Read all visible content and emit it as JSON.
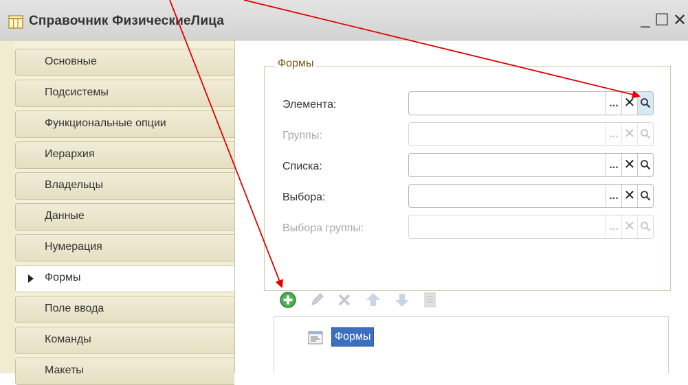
{
  "window": {
    "title": "Справочник ФизическиеЛица",
    "min_label": "_",
    "max_label": "☐",
    "close_label": "✕"
  },
  "nav": {
    "items": [
      {
        "label": "Основные"
      },
      {
        "label": "Подсистемы"
      },
      {
        "label": "Функциональные опции"
      },
      {
        "label": "Иерархия"
      },
      {
        "label": "Владельцы"
      },
      {
        "label": "Данные"
      },
      {
        "label": "Нумерация"
      },
      {
        "label": "Формы",
        "active": true
      },
      {
        "label": "Поле ввода"
      },
      {
        "label": "Команды"
      },
      {
        "label": "Макеты"
      }
    ]
  },
  "forms_group": {
    "title": "Формы",
    "fields": [
      {
        "label": "Элемента:",
        "value": "",
        "enabled": true
      },
      {
        "label": "Группы:",
        "value": "",
        "enabled": false
      },
      {
        "label": "Списка:",
        "value": "",
        "enabled": true
      },
      {
        "label": "Выбора:",
        "value": "",
        "enabled": true
      },
      {
        "label": "Выбора группы:",
        "value": "",
        "enabled": false
      }
    ],
    "field_buttons": {
      "select": "...",
      "clear": "✕",
      "open": "search-icon"
    }
  },
  "toolbar": {
    "icons": [
      "add-icon",
      "edit-icon",
      "delete-icon",
      "move-up-icon",
      "move-down-icon",
      "properties-icon"
    ]
  },
  "tree": {
    "nodes": [
      {
        "label": "Формы",
        "selected": true
      }
    ]
  },
  "colors": {
    "accent_selected": "#3d6fc1",
    "group_title": "#7b5a1c",
    "annotation_arrow": "#e00000",
    "add_icon_green": "#4caf50"
  }
}
